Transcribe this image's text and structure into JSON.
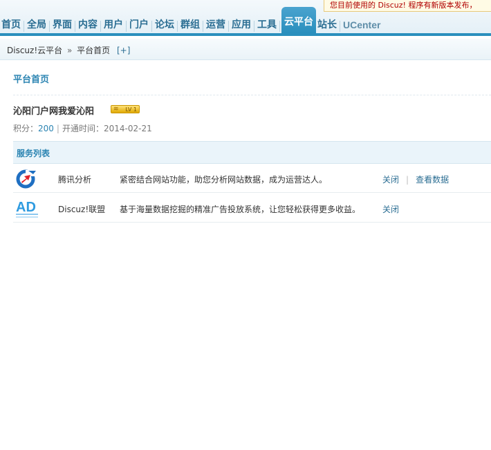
{
  "notice": "您目前使用的 Discuz! 程序有新版本发布，",
  "nav": {
    "items": [
      "首页",
      "全局",
      "界面",
      "内容",
      "用户",
      "门户",
      "论坛",
      "群组",
      "运营",
      "应用",
      "工具",
      "云平台",
      "站长",
      "UCenter"
    ],
    "active": "云平台"
  },
  "breadcrumb": {
    "root": "Discuz!云平台",
    "separator": "»",
    "current": "平台首页",
    "add": "[+]"
  },
  "page_title": "平台首页",
  "site": {
    "name": "沁阳门户网我爱沁阳",
    "level_badge": "LV 1",
    "points_label": "积分：",
    "points": "200",
    "open_label": "开通时间：",
    "open_date": "2014-02-21"
  },
  "services": {
    "title": "服务列表",
    "rows": [
      {
        "icon": "tencent-analytics-icon",
        "name": "腾讯分析",
        "desc": "紧密结合网站功能，助您分析网站数据，成为运营达人。",
        "actions": [
          "关闭",
          "查看数据"
        ]
      },
      {
        "icon": "ad-union-icon",
        "name": "Discuz!联盟",
        "desc": "基于海量数据挖掘的精准广告投放系统，让您轻松获得更多收益。",
        "actions": [
          "关闭"
        ]
      }
    ]
  },
  "colors": {
    "nav_active": "#2a8fbd",
    "link": "#2b6e93",
    "title": "#2b84b2",
    "notice_text": "#b00000"
  }
}
